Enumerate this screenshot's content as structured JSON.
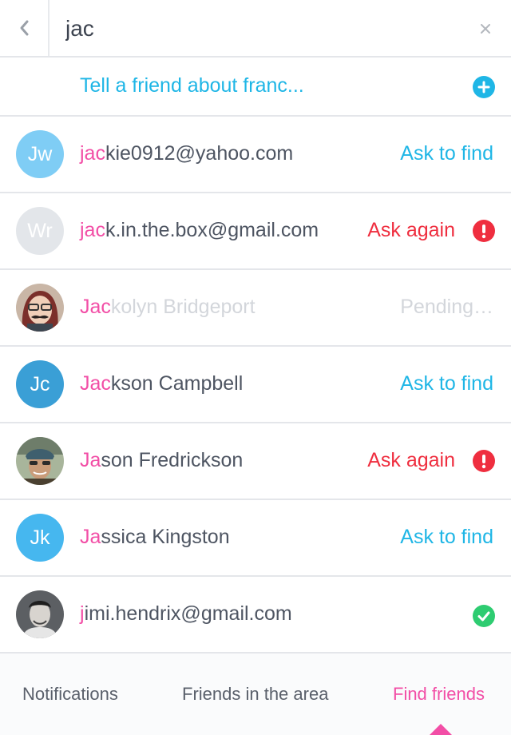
{
  "search": {
    "query": "jac",
    "back_icon": "chevron-left-icon",
    "clear_icon": "close-icon"
  },
  "invite": {
    "label": "Tell a friend about franc...",
    "icon": "plus-circle-icon"
  },
  "colors": {
    "accent_blue": "#1fb6e6",
    "highlight_pink": "#f24ea6",
    "alert_red": "#ef2e3f",
    "success_green": "#2ecc71",
    "muted": "#d3d6db"
  },
  "results": [
    {
      "initials": "Jw",
      "avatar_color": "#7fcdf5",
      "match": "jac",
      "rest": "kie0912@yahoo.com",
      "action": "Ask to find"
    },
    {
      "initials": "Wr",
      "avatar_color": "#e3e6ea",
      "match": "jac",
      "rest": "k.in.the.box@gmail.com",
      "action": "Ask again"
    },
    {
      "match": "Jac",
      "rest": "kolyn Bridgeport",
      "action": "Pending…"
    },
    {
      "initials": "Jc",
      "avatar_color": "#3a9fd6",
      "match": "Jac",
      "rest": "kson Campbell",
      "action": "Ask to find"
    },
    {
      "match": "Ja",
      "rest": "son Fredrickson",
      "action": "Ask again"
    },
    {
      "initials": "Jk",
      "avatar_color": "#46b7ef",
      "match": "Ja",
      "rest": "ssica Kingston",
      "action": "Ask to find"
    },
    {
      "match": "j",
      "rest": "imi.hendrix@gmail.com",
      "action_icon": "check-circle-icon"
    }
  ],
  "tabs": [
    {
      "label": "Notifications"
    },
    {
      "label": "Friends in the area"
    },
    {
      "label": "Find friends",
      "active": true
    }
  ]
}
